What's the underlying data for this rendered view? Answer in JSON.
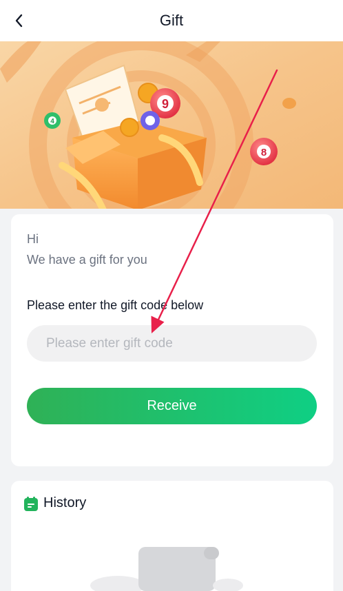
{
  "header": {
    "title": "Gift"
  },
  "icons": {
    "back": "chevron-left-icon",
    "history": "calendar-icon"
  },
  "gift_card": {
    "greeting": "Hi",
    "subtitle": "We have a gift for you",
    "code_label": "Please enter the gift code below",
    "code_placeholder": "Please enter gift code",
    "code_value": "",
    "receive_label": "Receive"
  },
  "history": {
    "title": "History"
  },
  "colors": {
    "accent_start": "#2fb156",
    "accent_end": "#0fcf84",
    "arrow": "#e8204a",
    "banner": "#f6c68e"
  }
}
